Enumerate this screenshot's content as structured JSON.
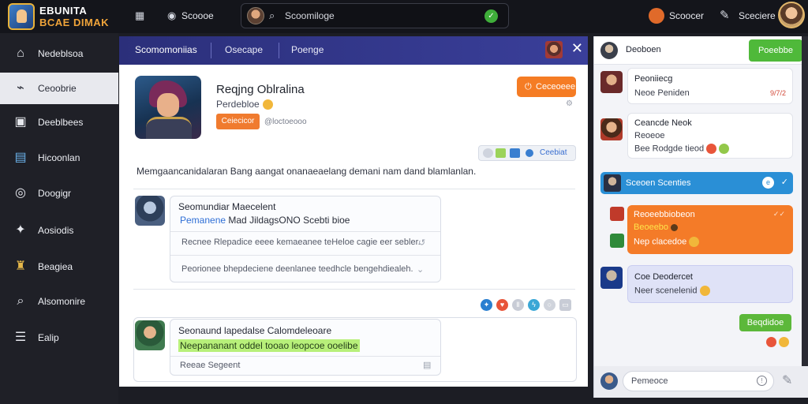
{
  "app": {
    "logo_line1": "EBUNITA",
    "logo_line2": "BCAE DIMAK"
  },
  "topbar": {
    "grid_label": "",
    "nav_label": "Scoooe",
    "search_placeholder": "Scoomiloge",
    "user_link_label": "Scoocer",
    "settings_label": "Sceciere"
  },
  "sidebar": {
    "items": [
      {
        "label": "Nedeblsoa",
        "icon": "home-icon",
        "active": false
      },
      {
        "label": "Ceoobrie",
        "icon": "chart-icon",
        "active": true
      },
      {
        "label": "Deeblbees",
        "icon": "calendar-icon",
        "active": false
      },
      {
        "label": "Hicoonlan",
        "icon": "photo-icon",
        "active": false
      },
      {
        "label": "Doogigr",
        "icon": "target-icon",
        "active": false
      },
      {
        "label": "Aosiodis",
        "icon": "pin-icon",
        "active": false
      },
      {
        "label": "Beagiea",
        "icon": "trophy-icon",
        "active": false
      },
      {
        "label": "Alsomonire",
        "icon": "search-icon",
        "active": false
      },
      {
        "label": "Ealip",
        "icon": "list-icon",
        "active": false
      }
    ]
  },
  "main": {
    "tabs": [
      "Scomomoniias",
      "Osecape",
      "Poenge"
    ],
    "game_title": "Reqjng Oblralina",
    "game_subtitle": "Perdebloe",
    "small_button": "Ceiecicor",
    "small_meta": "@loctoeooo",
    "action_button": "Ceceoeee",
    "toolbar_label": "Ceebiat",
    "description": "Memgaancanidalaran Bang aangat onanaeaelang demani nam dand blamlanlan.",
    "post1": {
      "title": "Seomundiar Maecelent",
      "line_blue": "Pemanene",
      "line_rest": "Mad JildagsONO Scebti bioe",
      "reply1": "Recnee Rlepadice eeee kemaeanee teHeloe cagie eer sebler.",
      "reply2": "Peorionee bhepdeciene deenlanee teedhcle bengehdiealeh."
    },
    "post2": {
      "title": "Seonaund lapedalse Calomdeleoare",
      "line_highlight": "Neepananant oddel tooao leopcoe ooelibe",
      "reply1": "Reeae Segeent"
    }
  },
  "chat": {
    "header_title": "Deoboen",
    "header_button": "Poeebbe",
    "messages": [
      {
        "name": "Peoniiecg",
        "text": "Neoe Peniden",
        "time": "9/7/2"
      },
      {
        "name": "Ceancde Neok",
        "text": "Reoeoe",
        "text2": "Bee Rodgde tieod"
      },
      {
        "name": "Sceoen Scenties",
        "kind": "blue"
      },
      {
        "name": "Reoeebbiobeon",
        "text": "Beoeebo",
        "text2": "Nep clacedoe",
        "kind": "orange"
      },
      {
        "name": "Coe Deodercet",
        "text": "Neer scenelenid",
        "kind": "lavender"
      }
    ],
    "pill_button": "Beqdidoe",
    "input_placeholder": "Pemeoce"
  },
  "colors": {
    "accent_purple": "#2f3383",
    "accent_orange": "#f57c24",
    "accent_green": "#4fb93a",
    "accent_blue": "#2a8fd6"
  }
}
